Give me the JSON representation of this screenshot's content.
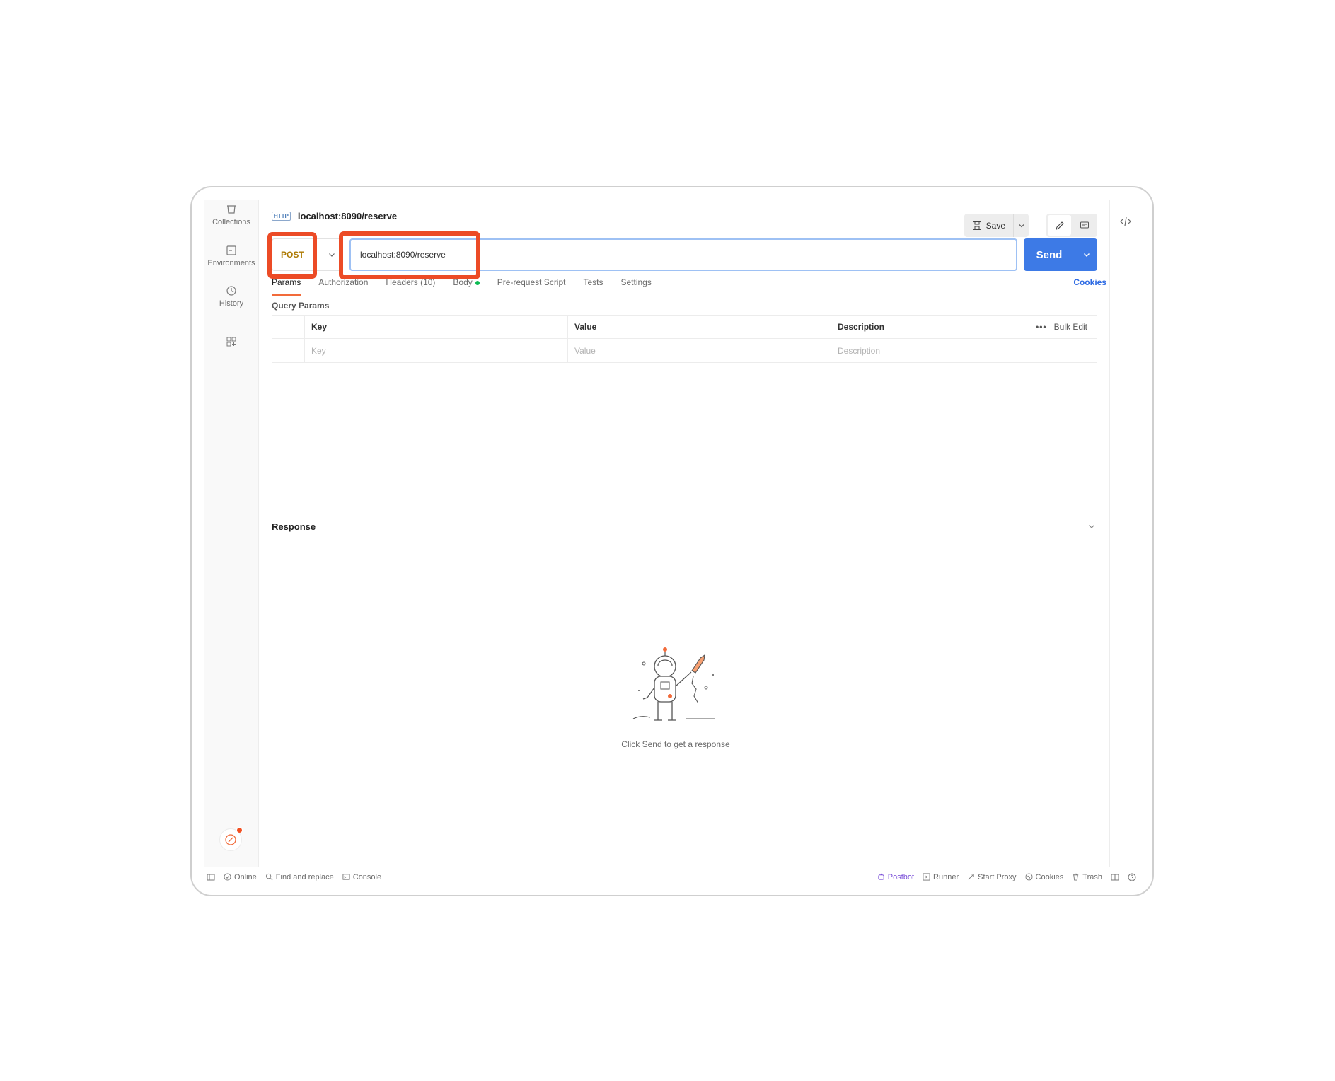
{
  "sidebar": {
    "items": [
      {
        "label": "Collections",
        "icon": "trash-can-like-icon"
      },
      {
        "label": "Environments",
        "icon": "environment-icon"
      },
      {
        "label": "History",
        "icon": "history-icon"
      },
      {
        "label": "",
        "icon": "add-workspace-icon"
      }
    ]
  },
  "header": {
    "badge": "HTTP",
    "title": "localhost:8090/reserve",
    "save_label": "Save"
  },
  "request": {
    "method": "POST",
    "url": "localhost:8090/reserve",
    "send_label": "Send"
  },
  "tabs": [
    {
      "label": "Params",
      "active": true
    },
    {
      "label": "Authorization",
      "active": false
    },
    {
      "label": "Headers (10)",
      "active": false
    },
    {
      "label": "Body",
      "active": false,
      "dot": true
    },
    {
      "label": "Pre-request Script",
      "active": false
    },
    {
      "label": "Tests",
      "active": false
    },
    {
      "label": "Settings",
      "active": false
    }
  ],
  "cookies_link": "Cookies",
  "query_params": {
    "title": "Query Params",
    "headers": {
      "key": "Key",
      "value": "Value",
      "description": "Description"
    },
    "bulk_edit": "Bulk Edit",
    "placeholders": {
      "key": "Key",
      "value": "Value",
      "description": "Description"
    }
  },
  "response": {
    "title": "Response",
    "empty_text": "Click Send to get a response"
  },
  "statusbar": {
    "left": [
      "Online",
      "Find and replace",
      "Console"
    ],
    "right": [
      "Postbot",
      "Runner",
      "Start Proxy",
      "Cookies",
      "Trash"
    ]
  },
  "colors": {
    "method": "#ad7a03",
    "send": "#3d7ae6",
    "highlight": "#ec4b26",
    "active_tab": "#f26b3a",
    "link": "#2d6ae3"
  }
}
